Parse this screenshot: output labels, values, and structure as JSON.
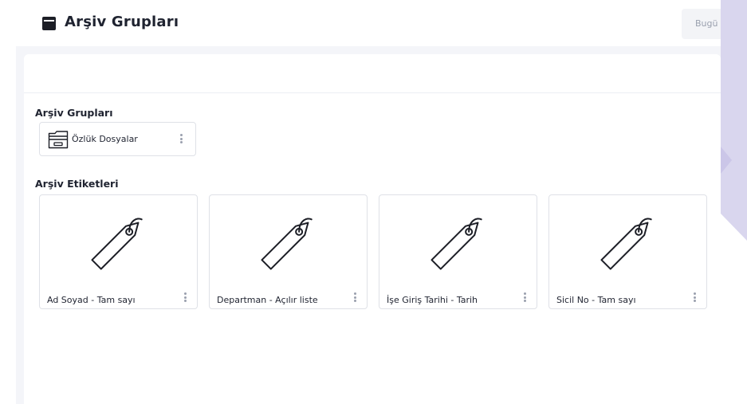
{
  "header": {
    "title": "Arşiv Grupları",
    "button_label": "Bugü"
  },
  "sections": {
    "groups_title": "Arşiv Grupları",
    "tags_title": "Arşiv Etiketleri"
  },
  "groups": [
    {
      "label": "Özlük Dosyalar",
      "icon": "folder-drawer-icon"
    }
  ],
  "tags": [
    {
      "label": "Ad Soyad - Tam sayı",
      "icon": "tag-icon"
    },
    {
      "label": "Departman - Açılır liste",
      "icon": "tag-icon"
    },
    {
      "label": "İşe Giriş Tarihi - Tarih",
      "icon": "tag-icon"
    },
    {
      "label": "Sicil No - Tam sayı",
      "icon": "tag-icon"
    }
  ],
  "colors": {
    "side_panel": "#d9d6ee",
    "side_arrow": "#cbc6e8",
    "page_bg": "#f4f5f9"
  }
}
